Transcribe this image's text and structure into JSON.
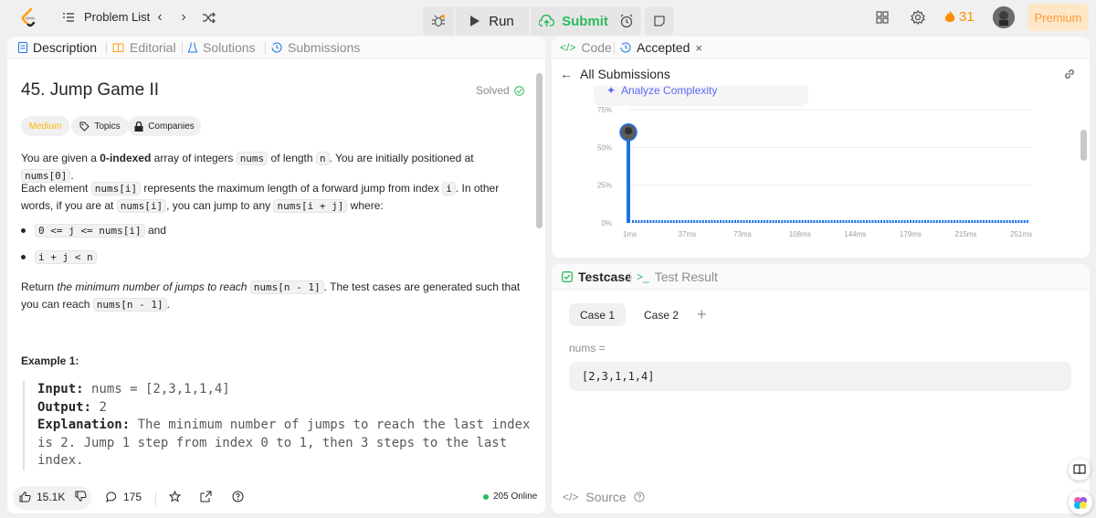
{
  "topbar": {
    "problem_list": "Problem List",
    "run": "Run",
    "submit": "Submit",
    "streak": "31",
    "premium": "Premium"
  },
  "left_tabs": {
    "description": "Description",
    "editorial": "Editorial",
    "solutions": "Solutions",
    "submissions": "Submissions"
  },
  "problem": {
    "title": "45. Jump Game II",
    "solved": "Solved",
    "difficulty": "Medium",
    "topics": "Topics",
    "companies": "Companies",
    "p1_a": "You are given a ",
    "p1_b": "0-indexed",
    "p1_c": " array of integers ",
    "p1_code1": "nums",
    "p1_d": " of length ",
    "p1_code2": "n",
    "p1_e": ". You are initially positioned at ",
    "p1_code3": "nums[0]",
    "p1_f": ".",
    "p2_a": "Each element ",
    "p2_code1": "nums[i]",
    "p2_b": " represents the maximum length of a forward jump from index ",
    "p2_code2": "i",
    "p2_c": ". In other words, if you are at ",
    "p2_code3": "nums[i]",
    "p2_d": ", you can jump to any ",
    "p2_code4": "nums[i + j]",
    "p2_e": " where:",
    "b1_code1": "0 <= j <= nums[i]",
    "b1_text": "and",
    "b2_code": "i + j < n",
    "p3_a": "Return ",
    "p3_em": "the minimum number of jumps to reach",
    "p3_code1": "nums[n - 1]",
    "p3_b": ". The test cases are generated such that you can reach ",
    "p3_code2": "nums[n - 1]",
    "p3_c": ".",
    "example_heading": "Example 1:",
    "ex_input_label": "Input:",
    "ex_input_value": " nums = [2,3,1,1,4]",
    "ex_output_label": "Output:",
    "ex_output_value": " 2",
    "ex_expl_label": "Explanation:",
    "ex_expl_line1": " The minimum number of jumps to reach the last index",
    "ex_expl_line2": "is 2. Jump 1 step from index 0 to 1, then 3 steps to the last",
    "ex_expl_line3": "index."
  },
  "left_footer": {
    "likes": "15.1K",
    "comments": "175",
    "online": "205 Online"
  },
  "right_tabs": {
    "code": "Code",
    "accepted": "Accepted"
  },
  "submissions": {
    "all_submissions": "All Submissions",
    "analyze": "Analyze Complexity"
  },
  "chart_data": {
    "type": "bar",
    "y_ticks": [
      "75%",
      "50%",
      "25%",
      "0%"
    ],
    "x_ticks": [
      "1ms",
      "37ms",
      "73ms",
      "108ms",
      "144ms",
      "179ms",
      "215ms",
      "251ms"
    ],
    "ylim": [
      0,
      75
    ],
    "highlight_bar": {
      "x": "1ms",
      "value": 60
    },
    "baseline_note": "remaining runtimes near 0%",
    "bar_color": "#1a73e8"
  },
  "bottom_tabs": {
    "testcase": "Testcase",
    "test_result": "Test Result"
  },
  "testcase": {
    "case1": "Case 1",
    "case2": "Case 2",
    "nums_label": "nums =",
    "nums_value": "[2,3,1,1,4]",
    "source": "Source"
  }
}
